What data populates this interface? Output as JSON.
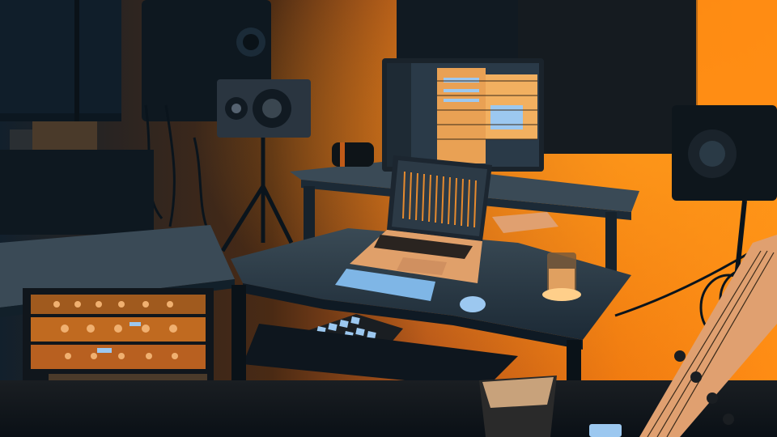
{
  "scene": {
    "kind": "photo",
    "subject": "home-studio",
    "palette": {
      "shadow_blue": "#0e1c28",
      "deep_blue": "#142a3a",
      "orange": "#f07a10",
      "hot_orange": "#ff9a1a",
      "warm_wall": "#c4641a",
      "screen_blue": "#7fb6e6",
      "pale_blue": "#9cc8f0"
    }
  }
}
